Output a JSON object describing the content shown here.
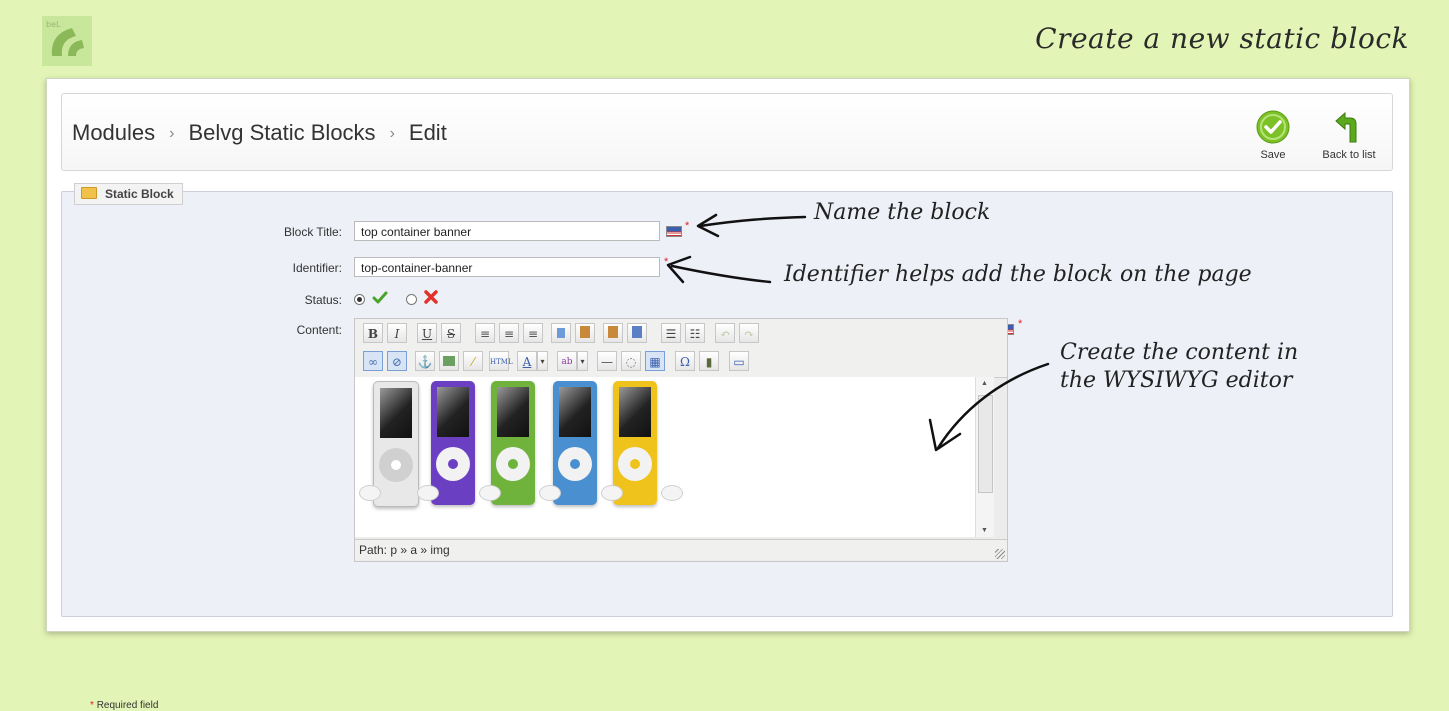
{
  "page_heading": "Create a new static block",
  "logo_icon": "belvg-logo-icon",
  "breadcrumb": [
    "Modules",
    "Belvg Static Blocks",
    "Edit"
  ],
  "breadcrumb_separator": "›",
  "toolbar": {
    "save_label": "Save",
    "back_label": "Back to list"
  },
  "fieldset_legend": "Static Block",
  "form": {
    "block_title_label": "Block Title:",
    "block_title_value": "top container banner",
    "identifier_label": "Identifier:",
    "identifier_value": "top-container-banner",
    "status_label": "Status:",
    "status_selected": "enabled",
    "content_label": "Content:",
    "required_marker": "*"
  },
  "editor": {
    "path_text": "Path: p » a » img",
    "toolbar_row1": [
      "bold",
      "italic",
      "underline",
      "strikethrough",
      "align-left",
      "align-center",
      "align-right",
      "copy",
      "paste",
      "paste-text",
      "paste-word",
      "bullet-list",
      "numbered-list",
      "undo",
      "redo"
    ],
    "toolbar_row2": [
      "link",
      "unlink",
      "anchor",
      "image",
      "cleanup",
      "html",
      "text-color",
      "background-color",
      "horizontal-rule",
      "remove-format",
      "table",
      "special-char",
      "media",
      "template"
    ],
    "ipod_colors": [
      "#e8e8e8",
      "#6a3fc2",
      "#6fb23c",
      "#4a8fd0",
      "#f0c21c"
    ]
  },
  "annotations": {
    "name_block": "Name the block",
    "identifier_help": "Identifier helps add the block on the page",
    "content_help": [
      "Create the content in",
      "the WYSIWYG editor"
    ]
  },
  "required_note": "Required field",
  "colors": {
    "background": "#e3f5b6",
    "save_green": "#7cc227",
    "back_green": "#5aa91e"
  }
}
